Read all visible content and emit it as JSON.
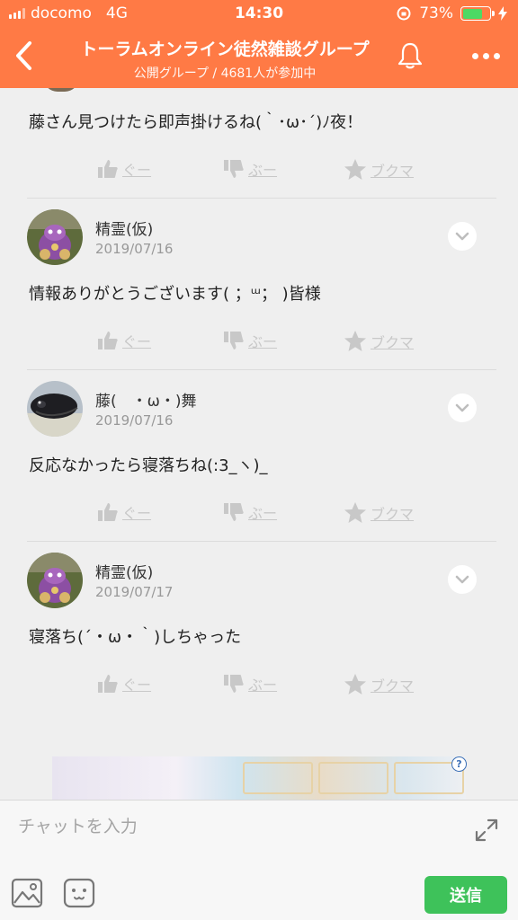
{
  "status": {
    "carrier": "docomo",
    "network": "4G",
    "time": "14:30",
    "battery": "73%",
    "battery_level": 0.73
  },
  "header": {
    "title": "トーラムオンライン徒然雑談グループ",
    "subtitle": "公開グループ / 4681人が参加中",
    "color": "#ff7a45"
  },
  "actions": {
    "like": "ぐー",
    "dislike": "ぶー",
    "bookmark": "ブクマ"
  },
  "posts": [
    {
      "message": "藤さん見つけたら即声掛けるね(｀･ω･´)ﾉ夜！"
    },
    {
      "author": "精霊(仮)",
      "date": "2019/07/16",
      "message": "情報ありがとうございます( ；ᵚ； )皆様"
    },
    {
      "author": "藤(　・ω・)舞",
      "date": "2019/07/16",
      "message": "反応なかったら寝落ちね(:3_ヽ)_"
    },
    {
      "author": "精霊(仮)",
      "date": "2019/07/17",
      "message": "寝落ち(´・ω・｀)しちゃった"
    }
  ],
  "composer": {
    "placeholder": "チャットを入力",
    "send": "送信",
    "send_color": "#3ec25a"
  }
}
